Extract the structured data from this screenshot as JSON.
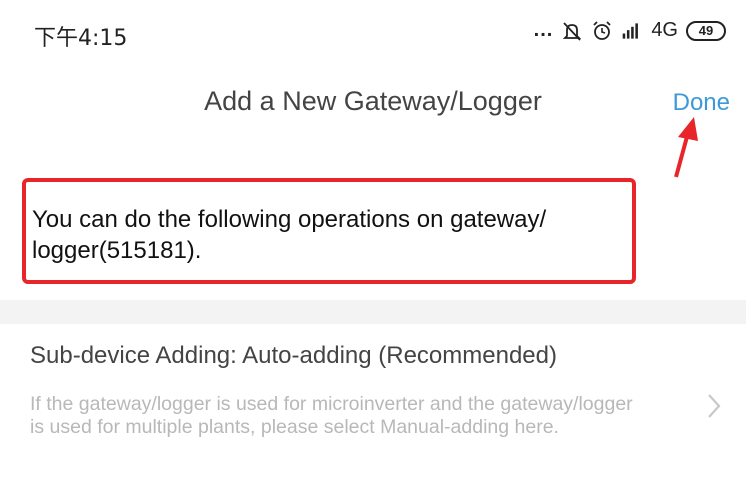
{
  "status_bar": {
    "time": "下午4:15",
    "dots": "...",
    "network": "4G",
    "battery": "49"
  },
  "header": {
    "title": "Add a New Gateway/Logger",
    "done_label": "Done"
  },
  "notice": {
    "text": "You can do the following operations on gateway/ logger(515181)."
  },
  "sub_device": {
    "title": "Sub-device Adding: Auto-adding (Recommended)",
    "description": "If the gateway/logger is used for microinverter and the gateway/logger is used for multiple plants, please select Manual-adding here."
  },
  "colors": {
    "accent": "#3d9ad8",
    "highlight": "#e8262a",
    "muted": "#b8b8b8"
  },
  "icons": [
    "mute-icon",
    "alarm-icon",
    "signal-icon",
    "battery-icon",
    "arrow-annotation",
    "chevron-right-icon"
  ]
}
